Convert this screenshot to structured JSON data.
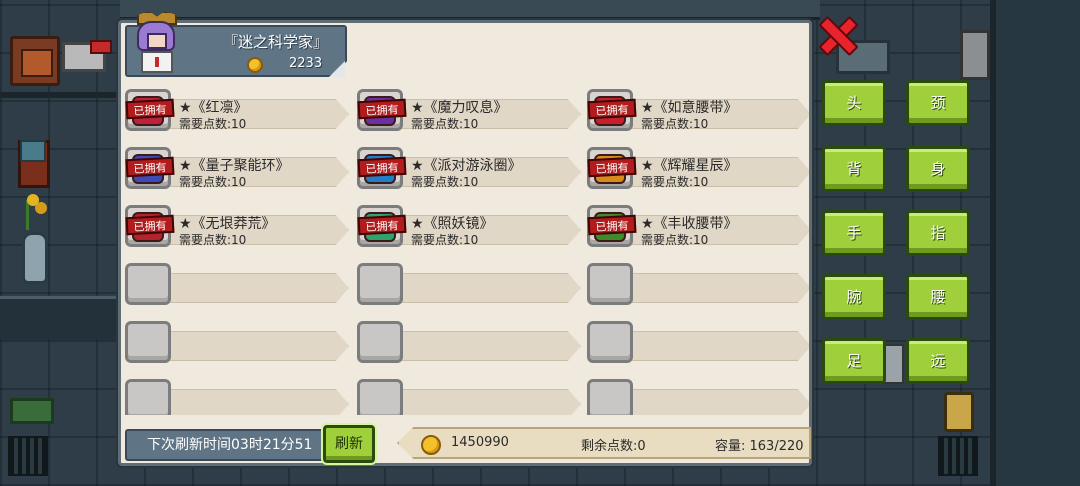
{
  "header": {
    "title": "『迷之科学家』",
    "gold": "2233"
  },
  "owned_label": "已拥有",
  "items": [
    {
      "name": "★《红凛》",
      "cost": "需要点数:10",
      "owned": true,
      "color": "#c0213a"
    },
    {
      "name": "★《魔力叹息》",
      "cost": "需要点数:10",
      "owned": true,
      "color": "#6a2fa0"
    },
    {
      "name": "★《如意腰带》",
      "cost": "需要点数:10",
      "owned": true,
      "color": "#c8202a"
    },
    {
      "name": "★《量子聚能环》",
      "cost": "需要点数:10",
      "owned": true,
      "color": "#3b4bb8"
    },
    {
      "name": "★《派对游泳圈》",
      "cost": "需要点数:10",
      "owned": true,
      "color": "#1f7fc9"
    },
    {
      "name": "★《辉耀星辰》",
      "cost": "需要点数:10",
      "owned": true,
      "color": "#d98b1a"
    },
    {
      "name": "★《无垠莽荒》",
      "cost": "需要点数:10",
      "owned": true,
      "color": "#b3232c"
    },
    {
      "name": "★《照妖镜》",
      "cost": "需要点数:10",
      "owned": true,
      "color": "#2fa36b"
    },
    {
      "name": "★《丰收腰带》",
      "cost": "需要点数:10",
      "owned": true,
      "color": "#3f8a2a"
    },
    {
      "name": "",
      "cost": "",
      "owned": false
    },
    {
      "name": "",
      "cost": "",
      "owned": false
    },
    {
      "name": "",
      "cost": "",
      "owned": false
    },
    {
      "name": "",
      "cost": "",
      "owned": false
    },
    {
      "name": "",
      "cost": "",
      "owned": false
    },
    {
      "name": "",
      "cost": "",
      "owned": false
    },
    {
      "name": "",
      "cost": "",
      "owned": false
    },
    {
      "name": "",
      "cost": "",
      "owned": false
    },
    {
      "name": "",
      "cost": "",
      "owned": false
    }
  ],
  "footer": {
    "refresh_time": "下次刷新时间03时21分51",
    "refresh_button": "刷新",
    "gold": "1450990",
    "remaining_points": "剩余点数:0",
    "capacity": "容量: 163/220"
  },
  "slots": [
    "头",
    "颈",
    "背",
    "身",
    "手",
    "指",
    "腕",
    "腰",
    "足",
    "远"
  ],
  "colors": {
    "accent_green": "#9fd03c",
    "close_red": "#e8232b",
    "panel_bg": "#efe9de",
    "header_bg": "#5f7586"
  }
}
